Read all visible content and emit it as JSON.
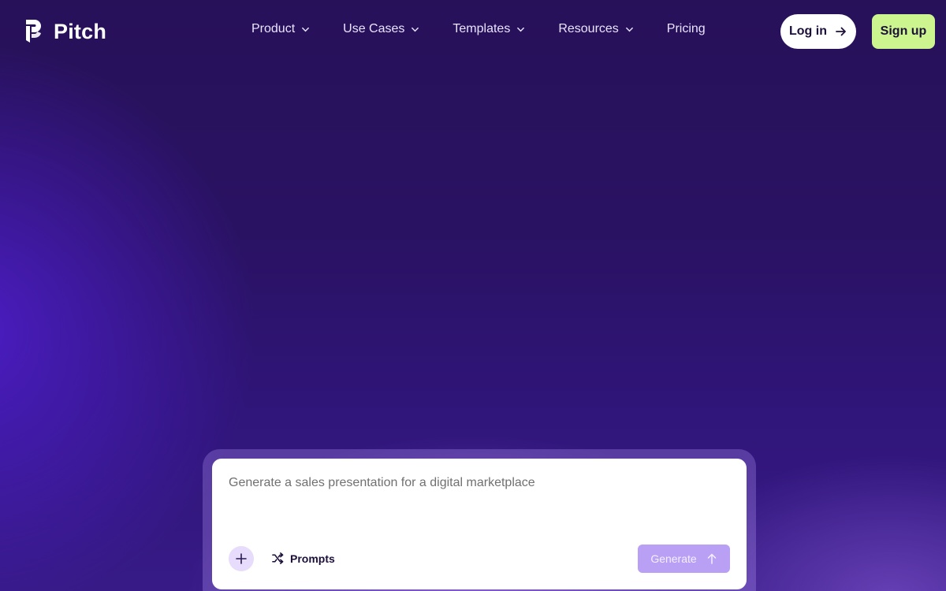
{
  "brand": {
    "name": "Pitch",
    "logo_icon": "pitch-logo-icon"
  },
  "nav": {
    "items": [
      {
        "label": "Product",
        "has_dropdown": true
      },
      {
        "label": "Use Cases",
        "has_dropdown": true
      },
      {
        "label": "Templates",
        "has_dropdown": true
      },
      {
        "label": "Resources",
        "has_dropdown": true
      },
      {
        "label": "Pricing",
        "has_dropdown": false
      }
    ],
    "login_label": "Log in",
    "signup_label": "Sign up"
  },
  "prompt": {
    "placeholder": "Generate a sales presentation for a digital marketplace",
    "prompts_label": "Prompts",
    "generate_label": "Generate"
  },
  "colors": {
    "background": "#2a1263",
    "signup_accent": "#ccf58f",
    "generate_button": "#b9a0f5"
  }
}
